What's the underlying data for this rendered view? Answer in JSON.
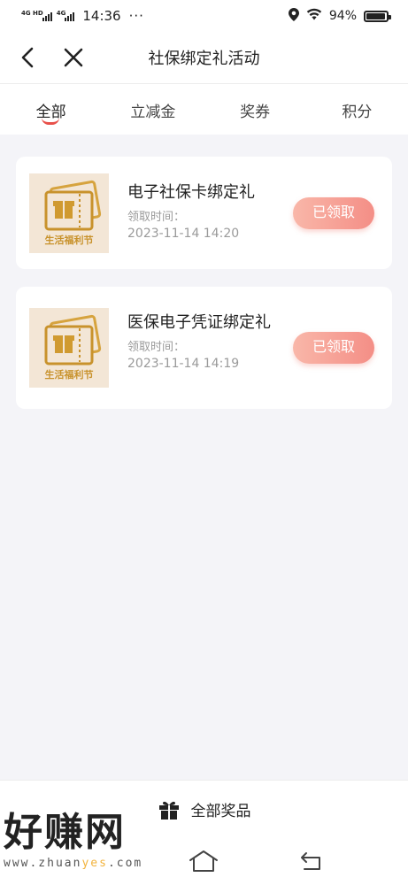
{
  "status_bar": {
    "signal_tag_1": "4G HD",
    "signal_tag_2": "4G",
    "time": "14:36",
    "more": "···",
    "battery": "94%"
  },
  "nav": {
    "title": "社保绑定礼活动"
  },
  "tabs": [
    {
      "label": "全部",
      "active": true
    },
    {
      "label": "立减金",
      "active": false
    },
    {
      "label": "奖券",
      "active": false
    },
    {
      "label": "积分",
      "active": false
    }
  ],
  "items": [
    {
      "title": "电子社保卡绑定礼",
      "thumb_caption": "生活福利节",
      "time_label": "领取时间：",
      "time": "2023-11-14 14:20",
      "status": "已领取"
    },
    {
      "title": "医保电子凭证绑定礼",
      "thumb_caption": "生活福利节",
      "time_label": "领取时间：",
      "time": "2023-11-14 14:19",
      "status": "已领取"
    }
  ],
  "bottom": {
    "all_prizes": "全部奖品",
    "watermark_title": "好赚网",
    "watermark_url_pre": "www.zhuan",
    "watermark_url_mid": "yes",
    "watermark_url_post": ".com"
  },
  "icons": {
    "back": "chevron-left-icon",
    "close": "close-icon",
    "gift": "gift-icon",
    "home": "home-icon",
    "return": "return-icon",
    "location": "location-icon",
    "wifi": "wifi-icon",
    "battery": "battery-icon"
  },
  "colors": {
    "accent": "#e8504a",
    "button_start": "#f9b7a9",
    "button_end": "#f48e86",
    "background": "#f4f4f8"
  }
}
